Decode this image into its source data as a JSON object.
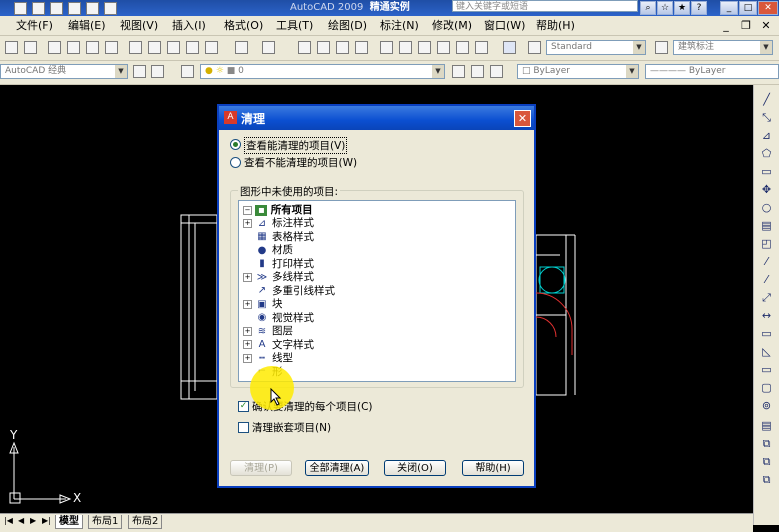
{
  "window": {
    "title_prefix": "AutoCAD 2009",
    "title_file": "精通实例",
    "search_placeholder": "键入关键字或短语"
  },
  "menu": [
    "文件(F)",
    "编辑(E)",
    "视图(V)",
    "插入(I)",
    "格式(O)",
    "工具(T)",
    "绘图(D)",
    "标注(N)",
    "修改(M)",
    "窗口(W)",
    "帮助(H)"
  ],
  "toolbar": {
    "text_style": "Standard",
    "dim_style": "建筑标注",
    "workspace": "AutoCAD 经典",
    "layer_value": "0",
    "color": "ByLayer",
    "linetype": "ByLayer"
  },
  "tabs": [
    "模型",
    "布局1",
    "布局2"
  ],
  "axis": {
    "y": "Y",
    "x": "X"
  },
  "dialog": {
    "title": "清理",
    "radio_view_purgeable": "查看能清理的项目(V)",
    "radio_view_non_purgeable": "查看不能清理的项目(W)",
    "group_label": "图形中未使用的项目:",
    "tree_root": "所有项目",
    "tree_items": [
      {
        "label": "标注样式",
        "expandable": true,
        "icon": "dim-style-icon",
        "glyph": "⊿"
      },
      {
        "label": "表格样式",
        "expandable": false,
        "icon": "table-style-icon",
        "glyph": "▦"
      },
      {
        "label": "材质",
        "expandable": false,
        "icon": "material-icon",
        "glyph": "●"
      },
      {
        "label": "打印样式",
        "expandable": false,
        "icon": "plot-style-icon",
        "glyph": "▮"
      },
      {
        "label": "多线样式",
        "expandable": true,
        "icon": "mline-style-icon",
        "glyph": "≫"
      },
      {
        "label": "多重引线样式",
        "expandable": false,
        "icon": "mleader-style-icon",
        "glyph": "↗"
      },
      {
        "label": "块",
        "expandable": true,
        "icon": "block-icon",
        "glyph": "▣"
      },
      {
        "label": "视觉样式",
        "expandable": false,
        "icon": "visual-style-icon",
        "glyph": "◉"
      },
      {
        "label": "图层",
        "expandable": true,
        "icon": "layer-icon",
        "glyph": "≋"
      },
      {
        "label": "文字样式",
        "expandable": true,
        "icon": "text-style-icon",
        "glyph": "A"
      },
      {
        "label": "线型",
        "expandable": true,
        "icon": "linetype-icon",
        "glyph": "┅"
      },
      {
        "label": "形",
        "expandable": false,
        "icon": "shape-icon",
        "glyph": "⌐"
      }
    ],
    "check_confirm": "确认要清理的每个项目(C)",
    "check_confirm_checked": true,
    "check_nested": "清理嵌套项目(N)",
    "check_nested_checked": false,
    "buttons": {
      "purge": "清理(P)",
      "purge_all": "全部清理(A)",
      "close": "关闭(O)",
      "help": "帮助(H)"
    }
  },
  "colors": {
    "title_bar": "#2c63c9",
    "dialog_border": "#0a3fbf",
    "drawing_bg": "#000000",
    "drawing_lines": "#ffffff",
    "highlight": "#ffeb00"
  }
}
